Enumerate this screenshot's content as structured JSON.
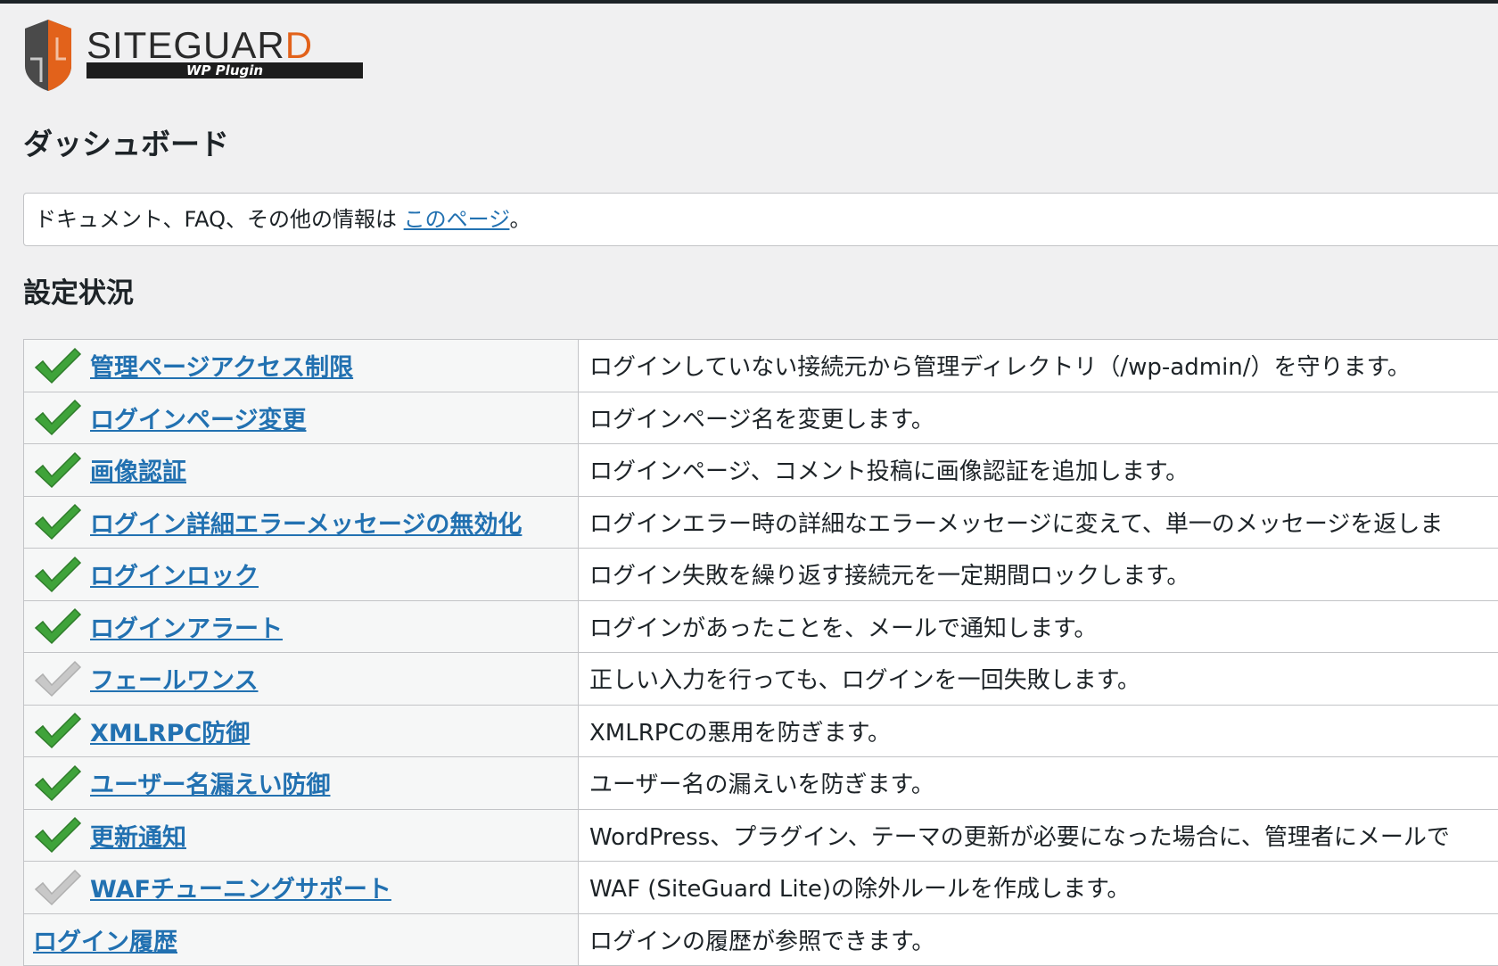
{
  "logo": {
    "brand_main": "SITEGUAR",
    "brand_last": "D",
    "sub": "WP Plugin"
  },
  "page": {
    "title": "ダッシュボード"
  },
  "notice": {
    "text": "ドキュメント、FAQ、その他の情報は ",
    "link": "このページ",
    "suffix": "。"
  },
  "section": {
    "title": "設定状況"
  },
  "colors": {
    "link": "#2271b1",
    "check_on": "#3fa33a",
    "check_off": "#c8c8c8"
  },
  "features": [
    {
      "name": "管理ページアクセス制限",
      "desc": "ログインしていない接続元から管理ディレクトリ（/wp-admin/）を守ります。",
      "enabled": true
    },
    {
      "name": "ログインページ変更",
      "desc": "ログインページ名を変更します。",
      "enabled": true
    },
    {
      "name": "画像認証",
      "desc": "ログインページ、コメント投稿に画像認証を追加します。",
      "enabled": true
    },
    {
      "name": "ログイン詳細エラーメッセージの無効化",
      "desc": "ログインエラー時の詳細なエラーメッセージに変えて、単一のメッセージを返しま",
      "enabled": true
    },
    {
      "name": "ログインロック",
      "desc": "ログイン失敗を繰り返す接続元を一定期間ロックします。",
      "enabled": true
    },
    {
      "name": "ログインアラート",
      "desc": "ログインがあったことを、メールで通知します。",
      "enabled": true
    },
    {
      "name": "フェールワンス",
      "desc": "正しい入力を行っても、ログインを一回失敗します。",
      "enabled": false
    },
    {
      "name": "XMLRPC防御",
      "desc": "XMLRPCの悪用を防ぎます。",
      "enabled": true
    },
    {
      "name": "ユーザー名漏えい防御",
      "desc": "ユーザー名の漏えいを防ぎます。",
      "enabled": true
    },
    {
      "name": "更新通知",
      "desc": "WordPress、プラグイン、テーマの更新が必要になった場合に、管理者にメールで",
      "enabled": true
    },
    {
      "name": "WAFチューニングサポート",
      "desc": "WAF (SiteGuard Lite)の除外ルールを作成します。",
      "enabled": false
    },
    {
      "name": "ログイン履歴",
      "desc": "ログインの履歴が参照できます。",
      "enabled": null
    }
  ]
}
